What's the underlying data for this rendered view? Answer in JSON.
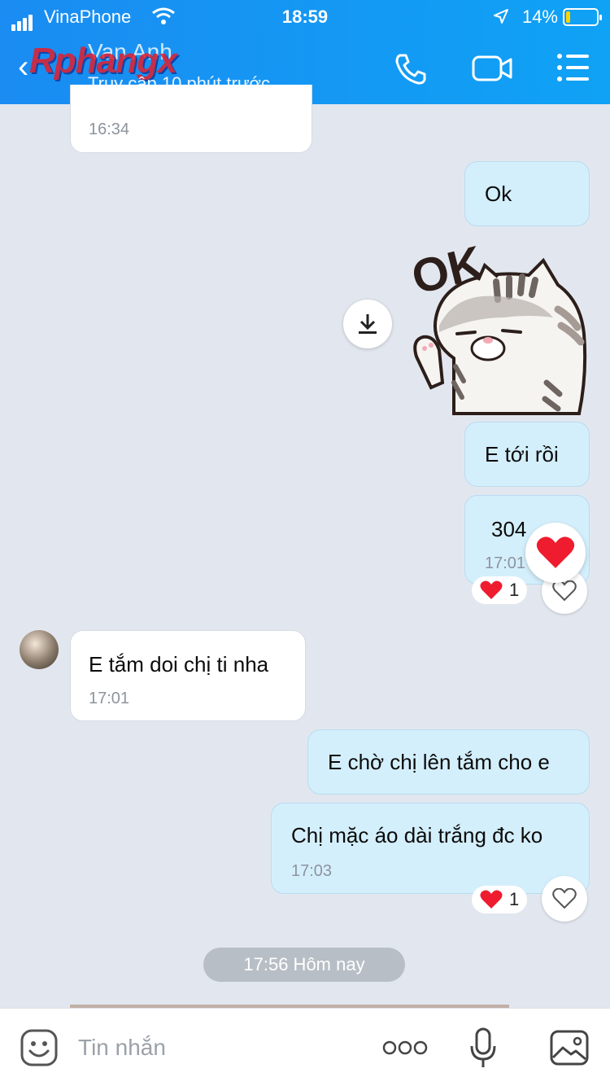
{
  "status_bar": {
    "carrier": "VinaPhone",
    "time": "18:59",
    "battery": "14%",
    "battery_level": 0.14
  },
  "header": {
    "watermark": "Rphangx",
    "contact_name": "Van Anh",
    "last_seen": "Truy cập 10 phút trước",
    "icons": [
      "back-arrow-icon",
      "phone-icon",
      "video-camera-icon",
      "menu-list-icon"
    ],
    "gradient": [
      "#1a8cf2",
      "#0fa2f5"
    ]
  },
  "messages": [
    {
      "id": "m1",
      "side": "in",
      "text": "",
      "time": "16:34"
    },
    {
      "id": "m2",
      "side": "out",
      "text": "Ok"
    },
    {
      "id": "m3",
      "side": "out",
      "type": "sticker",
      "sticker_text": "OK",
      "sticker": "cat-ok-sticker"
    },
    {
      "id": "m4",
      "side": "out",
      "text": "E tới rồi"
    },
    {
      "id": "m5",
      "side": "out",
      "text": "304",
      "time": "17:01",
      "reaction": "❤️",
      "reaction_count": "1"
    },
    {
      "id": "m6",
      "side": "in",
      "text": "E tắm doi chị ti nha",
      "time": "17:01"
    },
    {
      "id": "m7",
      "side": "out",
      "text": "E chờ chị lên tắm cho e"
    },
    {
      "id": "m8",
      "side": "out",
      "text": "Chị mặc áo dài trắng đc ko",
      "time": "17:03",
      "reaction": "❤️",
      "reaction_count": "1"
    }
  ],
  "date_divider": "17:56 Hôm nay",
  "input_bar": {
    "placeholder": "Tin nhắn",
    "icons": [
      "emoji-icon",
      "more-dots-icon",
      "microphone-icon",
      "image-icon"
    ]
  },
  "colors": {
    "chat_bg": "#e2e7ef",
    "outgoing_bubble": "#d4effc",
    "incoming_bubble": "#ffffff",
    "heart": "#ee1c2e"
  }
}
